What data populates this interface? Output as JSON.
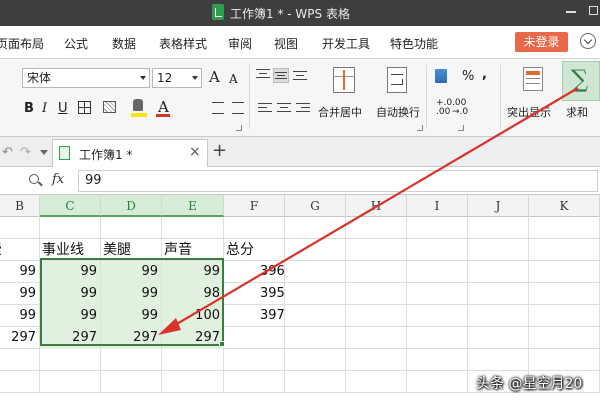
{
  "titlebar": {
    "title": "工作簿1 * - WPS 表格"
  },
  "menu": {
    "items": [
      "页面布局",
      "公式",
      "数据",
      "表格样式",
      "审阅",
      "视图",
      "开发工具",
      "特色功能"
    ],
    "login_label": "未登录"
  },
  "ribbon": {
    "font_name": "宋体",
    "font_size": "12",
    "grow_font": "A",
    "shrink_font": "A",
    "bold": "B",
    "italic": "I",
    "underline": "U",
    "font_color_glyph": "A",
    "merge_label": "合并居中",
    "wrap_label": "自动换行",
    "percent": "%",
    "comma": "⁾",
    "inc_decimal": "+.0\n.00",
    "dec_decimal": ".00\n→.0",
    "highlight_label": "突出显示",
    "sum_label": "求和",
    "sigma": "∑"
  },
  "tabbar": {
    "doc_title": "工作簿1 *",
    "close": "×",
    "add": "+"
  },
  "formula_bar": {
    "fx": "fx",
    "value": "99"
  },
  "columns": [
    "B",
    "C",
    "D",
    "E",
    "F",
    "G",
    "H",
    "I",
    "J",
    "K"
  ],
  "selected_columns": [
    "C",
    "D",
    "E"
  ],
  "sheet": {
    "header_row": [
      "费",
      "事业线",
      "美腿",
      "声音",
      "总分"
    ],
    "rows": [
      [
        "99",
        "99",
        "99",
        "99",
        "396"
      ],
      [
        "99",
        "99",
        "99",
        "98",
        "395"
      ],
      [
        "99",
        "99",
        "99",
        "100",
        "397"
      ],
      [
        "297",
        "297",
        "297",
        "297",
        ""
      ]
    ]
  },
  "watermark": "头条 @星空月20",
  "colors": {
    "accent_green": "#3a7d3c",
    "selection_fill": "#e2f1df",
    "arrow_red": "#d9342b",
    "login_orange": "#e8694a"
  }
}
